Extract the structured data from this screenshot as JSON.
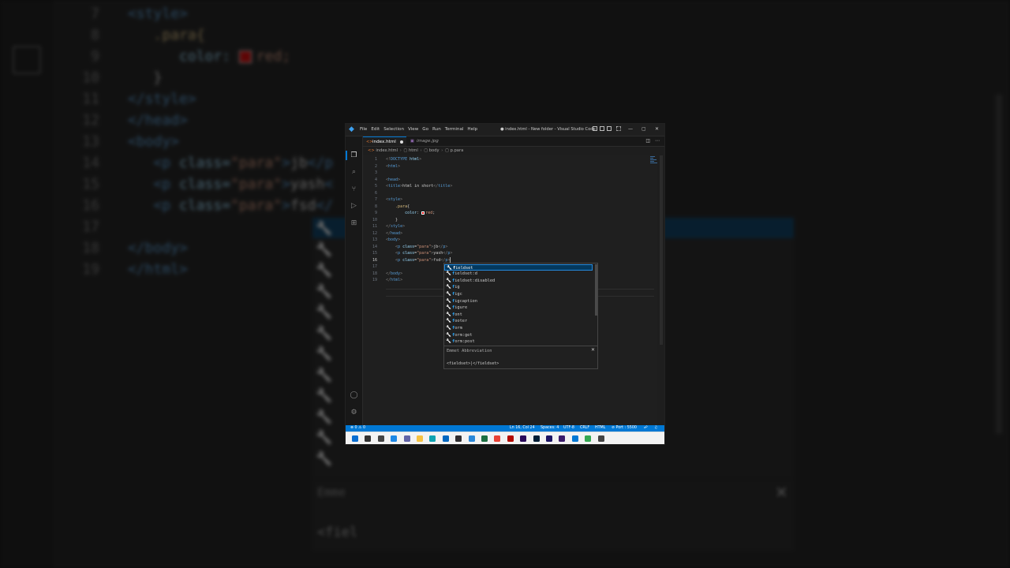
{
  "background": {
    "lines": [
      {
        "num": "7",
        "indent": 0,
        "parts": [
          [
            "tag",
            "<style>"
          ]
        ]
      },
      {
        "num": "8",
        "indent": 1,
        "parts": [
          [
            "sel",
            ".para{"
          ]
        ]
      },
      {
        "num": "9",
        "indent": 2,
        "parts": [
          [
            "attr",
            "color: "
          ],
          [
            "swatch",
            ""
          ],
          [
            "str",
            "red;"
          ]
        ]
      },
      {
        "num": "10",
        "indent": 1,
        "parts": [
          [
            "txt",
            "}"
          ]
        ]
      },
      {
        "num": "11",
        "indent": 0,
        "parts": [
          [
            "tag",
            "</style>"
          ]
        ]
      },
      {
        "num": "12",
        "indent": 0,
        "parts": [
          [
            "tag",
            "</head>"
          ]
        ]
      },
      {
        "num": "13",
        "indent": 0,
        "parts": [
          [
            "tag",
            "<body>"
          ]
        ]
      },
      {
        "num": "14",
        "indent": 1,
        "parts": [
          [
            "tag",
            "<p "
          ],
          [
            "attr",
            "class="
          ],
          [
            "str",
            "\"para\""
          ],
          [
            "tag",
            ">"
          ],
          [
            "txt",
            "jb"
          ],
          [
            "tag",
            "</p"
          ]
        ]
      },
      {
        "num": "15",
        "indent": 1,
        "parts": [
          [
            "tag",
            "<p "
          ],
          [
            "attr",
            "class="
          ],
          [
            "str",
            "\"para\""
          ],
          [
            "tag",
            ">"
          ],
          [
            "txt",
            "yash"
          ],
          [
            "tag",
            "<"
          ]
        ]
      },
      {
        "num": "16",
        "indent": 1,
        "parts": [
          [
            "tag",
            "<p "
          ],
          [
            "attr",
            "class="
          ],
          [
            "str",
            "\"para\""
          ],
          [
            "tag",
            ">"
          ],
          [
            "txt",
            "fsd"
          ],
          [
            "tag",
            "</"
          ]
        ]
      },
      {
        "num": "17",
        "indent": 0,
        "parts": []
      },
      {
        "num": "18",
        "indent": 0,
        "parts": [
          [
            "tag",
            "</body>"
          ]
        ]
      },
      {
        "num": "19",
        "indent": 0,
        "parts": [
          [
            "tag",
            "</html>"
          ]
        ]
      }
    ],
    "emmet_title": "Emme",
    "emmet_code": "<fiel"
  },
  "window": {
    "title": "● index.html - New folder - Visual Studio Code",
    "menu": [
      "File",
      "Edit",
      "Selection",
      "View",
      "Go",
      "Run",
      "Terminal",
      "Help"
    ]
  },
  "tabs": [
    {
      "label": "index.html",
      "icon": "html-file-icon",
      "active": true,
      "modified": true
    },
    {
      "label": "image.jpg",
      "icon": "image-file-icon",
      "active": false,
      "modified": false
    }
  ],
  "breadcrumb": [
    "index.html",
    "html",
    "body",
    "p.para"
  ],
  "code": [
    {
      "num": "1",
      "indent": 0,
      "parts": [
        [
          "brk",
          "<!"
        ],
        [
          "dt",
          "DOCTYPE"
        ],
        [
          "txt",
          " "
        ],
        [
          "attr",
          "html"
        ],
        [
          "brk",
          ">"
        ]
      ]
    },
    {
      "num": "2",
      "indent": 0,
      "parts": [
        [
          "brk",
          "<"
        ],
        [
          "tag",
          "html"
        ],
        [
          "brk",
          ">"
        ]
      ]
    },
    {
      "num": "3",
      "indent": 0,
      "parts": []
    },
    {
      "num": "4",
      "indent": 0,
      "parts": [
        [
          "brk",
          "<"
        ],
        [
          "tag",
          "head"
        ],
        [
          "brk",
          ">"
        ]
      ]
    },
    {
      "num": "5",
      "indent": 0,
      "parts": [
        [
          "brk",
          "<"
        ],
        [
          "tag",
          "title"
        ],
        [
          "brk",
          ">"
        ],
        [
          "txt",
          "html in short"
        ],
        [
          "brk",
          "</"
        ],
        [
          "tag",
          "title"
        ],
        [
          "brk",
          ">"
        ]
      ]
    },
    {
      "num": "6",
      "indent": 0,
      "parts": []
    },
    {
      "num": "7",
      "indent": 0,
      "parts": [
        [
          "brk",
          "<"
        ],
        [
          "tag",
          "style"
        ],
        [
          "brk",
          ">"
        ]
      ]
    },
    {
      "num": "8",
      "indent": 1,
      "parts": [
        [
          "sel",
          ".para"
        ],
        [
          "txt",
          "{"
        ]
      ]
    },
    {
      "num": "9",
      "indent": 2,
      "parts": [
        [
          "prop",
          "color"
        ],
        [
          "txt",
          ": "
        ],
        [
          "swatch",
          ""
        ],
        [
          "str",
          "red"
        ],
        [
          "txt",
          ";"
        ]
      ]
    },
    {
      "num": "10",
      "indent": 1,
      "parts": [
        [
          "txt",
          "}"
        ]
      ]
    },
    {
      "num": "11",
      "indent": 0,
      "parts": [
        [
          "brk",
          "</"
        ],
        [
          "tag",
          "style"
        ],
        [
          "brk",
          ">"
        ]
      ]
    },
    {
      "num": "12",
      "indent": 0,
      "parts": [
        [
          "brk",
          "</"
        ],
        [
          "tag",
          "head"
        ],
        [
          "brk",
          ">"
        ]
      ]
    },
    {
      "num": "13",
      "indent": 0,
      "parts": [
        [
          "brk",
          "<"
        ],
        [
          "tag",
          "body"
        ],
        [
          "brk",
          ">"
        ]
      ]
    },
    {
      "num": "14",
      "indent": 1,
      "parts": [
        [
          "brk",
          "<"
        ],
        [
          "tag",
          "p"
        ],
        [
          "txt",
          " "
        ],
        [
          "attr",
          "class"
        ],
        [
          "txt",
          "="
        ],
        [
          "str",
          "\"para\""
        ],
        [
          "brk",
          ">"
        ],
        [
          "txt",
          "jb"
        ],
        [
          "brk",
          "</"
        ],
        [
          "tag",
          "p"
        ],
        [
          "brk",
          ">"
        ]
      ]
    },
    {
      "num": "15",
      "indent": 1,
      "parts": [
        [
          "brk",
          "<"
        ],
        [
          "tag",
          "p"
        ],
        [
          "txt",
          " "
        ],
        [
          "attr",
          "class"
        ],
        [
          "txt",
          "="
        ],
        [
          "str",
          "\"para\""
        ],
        [
          "brk",
          ">"
        ],
        [
          "txt",
          "yash"
        ],
        [
          "brk",
          "</"
        ],
        [
          "tag",
          "p"
        ],
        [
          "brk",
          ">"
        ]
      ]
    },
    {
      "num": "16",
      "indent": 1,
      "parts": [
        [
          "brk",
          "<"
        ],
        [
          "tag",
          "p"
        ],
        [
          "txt",
          " "
        ],
        [
          "attr",
          "class"
        ],
        [
          "txt",
          "="
        ],
        [
          "str",
          "\"para\""
        ],
        [
          "brk",
          ">"
        ],
        [
          "txt",
          "fsd"
        ],
        [
          "brk",
          "</"
        ],
        [
          "tag",
          "p"
        ],
        [
          "brk",
          ">"
        ]
      ]
    },
    {
      "num": "17",
      "indent": 0,
      "parts": []
    },
    {
      "num": "18",
      "indent": 0,
      "parts": [
        [
          "brk",
          "</"
        ],
        [
          "tag",
          "body"
        ],
        [
          "brk",
          ">"
        ]
      ]
    },
    {
      "num": "19",
      "indent": 0,
      "parts": [
        [
          "brk",
          "</"
        ],
        [
          "tag",
          "html"
        ],
        [
          "brk",
          ">"
        ]
      ]
    }
  ],
  "current_line": "16",
  "suggestions": [
    {
      "match": "f",
      "rest": "ieldset",
      "selected": true
    },
    {
      "match": "f",
      "rest": "ieldset:d",
      "selected": false
    },
    {
      "match": "f",
      "rest": "ieldset:disabled",
      "selected": false
    },
    {
      "match": "f",
      "rest": "ig",
      "selected": false
    },
    {
      "match": "f",
      "rest": "igc",
      "selected": false
    },
    {
      "match": "f",
      "rest": "igcaption",
      "selected": false
    },
    {
      "match": "f",
      "rest": "igure",
      "selected": false
    },
    {
      "match": "f",
      "rest": "ont",
      "selected": false
    },
    {
      "match": "f",
      "rest": "ooter",
      "selected": false
    },
    {
      "match": "f",
      "rest": "orm",
      "selected": false
    },
    {
      "match": "f",
      "rest": "orm:get",
      "selected": false
    },
    {
      "match": "f",
      "rest": "orm:post",
      "selected": false
    }
  ],
  "details": {
    "title": "Emmet Abbreviation",
    "close": "✕",
    "code": "<fieldset>|</fieldset>"
  },
  "status": {
    "errors": "⊗ 0 ⚠ 0",
    "position": "Ln 16, Col 24",
    "spaces": "Spaces: 4",
    "encoding": "UTF-8",
    "eol": "CRLF",
    "language": "HTML",
    "port": "⊘ Port : 5500"
  },
  "colors": {
    "accent": "#0078d4",
    "editor_bg": "#1f1f1f",
    "selected_suggestion": "#04395e"
  },
  "taskbar_icons": [
    {
      "name": "windows-start-icon",
      "color": "#0a6ed1"
    },
    {
      "name": "search-icon",
      "color": "#333333"
    },
    {
      "name": "task-view-icon",
      "color": "#444444"
    },
    {
      "name": "widgets-icon",
      "color": "#1e88e5"
    },
    {
      "name": "chat-icon",
      "color": "#6264a7"
    },
    {
      "name": "file-explorer-icon",
      "color": "#f5c242"
    },
    {
      "name": "edge-icon",
      "color": "#0fa3b1"
    },
    {
      "name": "store-icon",
      "color": "#0067c0"
    },
    {
      "name": "obs-icon",
      "color": "#302e31"
    },
    {
      "name": "photos-icon",
      "color": "#2b88d8"
    },
    {
      "name": "excel-icon",
      "color": "#1d6f42"
    },
    {
      "name": "chrome-icon",
      "color": "#e94235"
    },
    {
      "name": "acrobat-icon",
      "color": "#b30b00"
    },
    {
      "name": "premiere-icon",
      "color": "#2a0a5a"
    },
    {
      "name": "photoshop-icon",
      "color": "#001e36"
    },
    {
      "name": "aftereffects-icon",
      "color": "#1b1464"
    },
    {
      "name": "illustrator-icon",
      "color": "#3b1c6b"
    },
    {
      "name": "vscode-icon",
      "color": "#0078d4"
    },
    {
      "name": "chrome-alt-icon",
      "color": "#34a853"
    },
    {
      "name": "checklist-icon",
      "color": "#444444"
    }
  ]
}
